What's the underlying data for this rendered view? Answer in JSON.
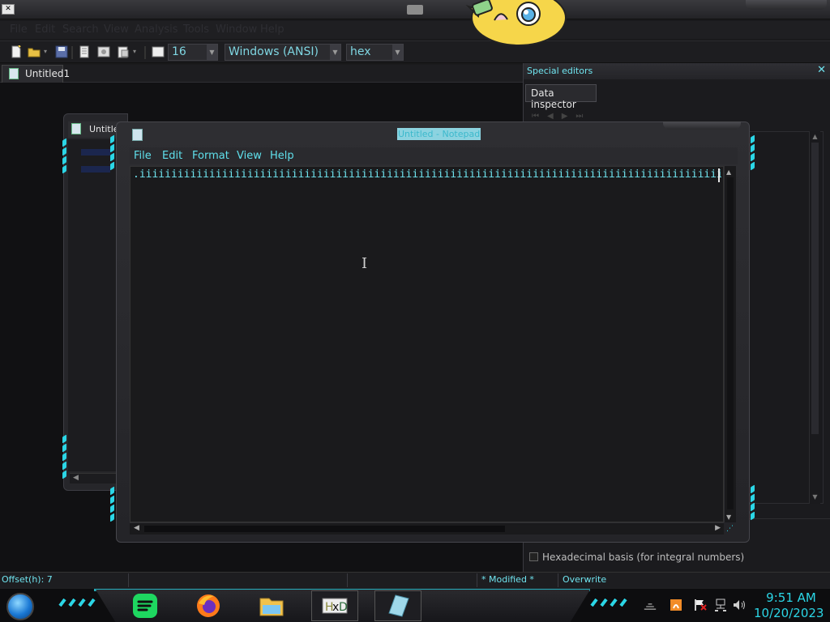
{
  "hxd": {
    "menu": [
      "File",
      "Edit",
      "Search",
      "View",
      "Analysis",
      "Tools",
      "Window",
      "Help"
    ],
    "toolbar": {
      "bytes_per_row": "16",
      "charset": "Windows (ANSI)",
      "offset_base": "hex"
    },
    "tab_label": "Untitled1",
    "child_tab_label": "Untitle",
    "special_editors": {
      "title": "Special editors",
      "tab_label": "Data inspector",
      "hex_basis_label": "Hexadecimal basis (for integral numbers)"
    },
    "status": {
      "offset": "Offset(h): 7",
      "modified": "* Modified *",
      "mode": "Overwrite"
    }
  },
  "notepad": {
    "title": "Untitled - Notepad",
    "menu": [
      "File",
      "Edit",
      "Format",
      "View",
      "Help"
    ],
    "content": ".iiiiiiiiiiiiiiiiiiiiiiiiiiiiiiiiiiiiiiiiiiiiiiiiiiiiiiiiiiiiiiiiiiiiiiiiiiiiiiiiiiiiiiiiiiiiiii"
  },
  "taskbar": {
    "apps": [
      "start-orb",
      "spotify-icon",
      "firefox-icon",
      "file-explorer-icon",
      "hxd-icon",
      "notepad-icon"
    ],
    "clock": {
      "time": "9:51 AM",
      "date": "10/20/2023"
    }
  },
  "colors": {
    "accent": "#2bd6e6",
    "background": "#1a1a1c"
  }
}
